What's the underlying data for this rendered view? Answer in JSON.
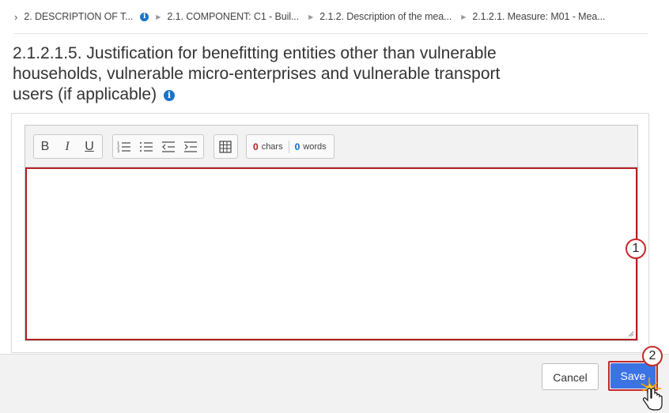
{
  "breadcrumb": {
    "items": [
      "2. DESCRIPTION OF T...",
      "2.1. COMPONENT: C1 - Buil...",
      "2.1.2. Description of the mea...",
      "2.1.2.1. Measure: M01 - Mea..."
    ]
  },
  "section": {
    "title": "2.1.2.1.5. Justification for benefitting entities other than vulnerable households, vulnerable micro-enterprises and vulnerable transport users (if applicable)"
  },
  "editor": {
    "toolbar": {
      "bold": "B",
      "italic": "I",
      "underline": "U"
    },
    "counter": {
      "chars_value": "0",
      "chars_label": "chars",
      "words_value": "0",
      "words_label": "words"
    },
    "content": ""
  },
  "callouts": {
    "one": "1",
    "two": "2"
  },
  "footer": {
    "cancel_label": "Cancel",
    "save_label": "Save"
  },
  "colors": {
    "accent_blue": "#3b73e4",
    "highlight_red": "#c62828",
    "info_blue": "#1a73c9"
  }
}
